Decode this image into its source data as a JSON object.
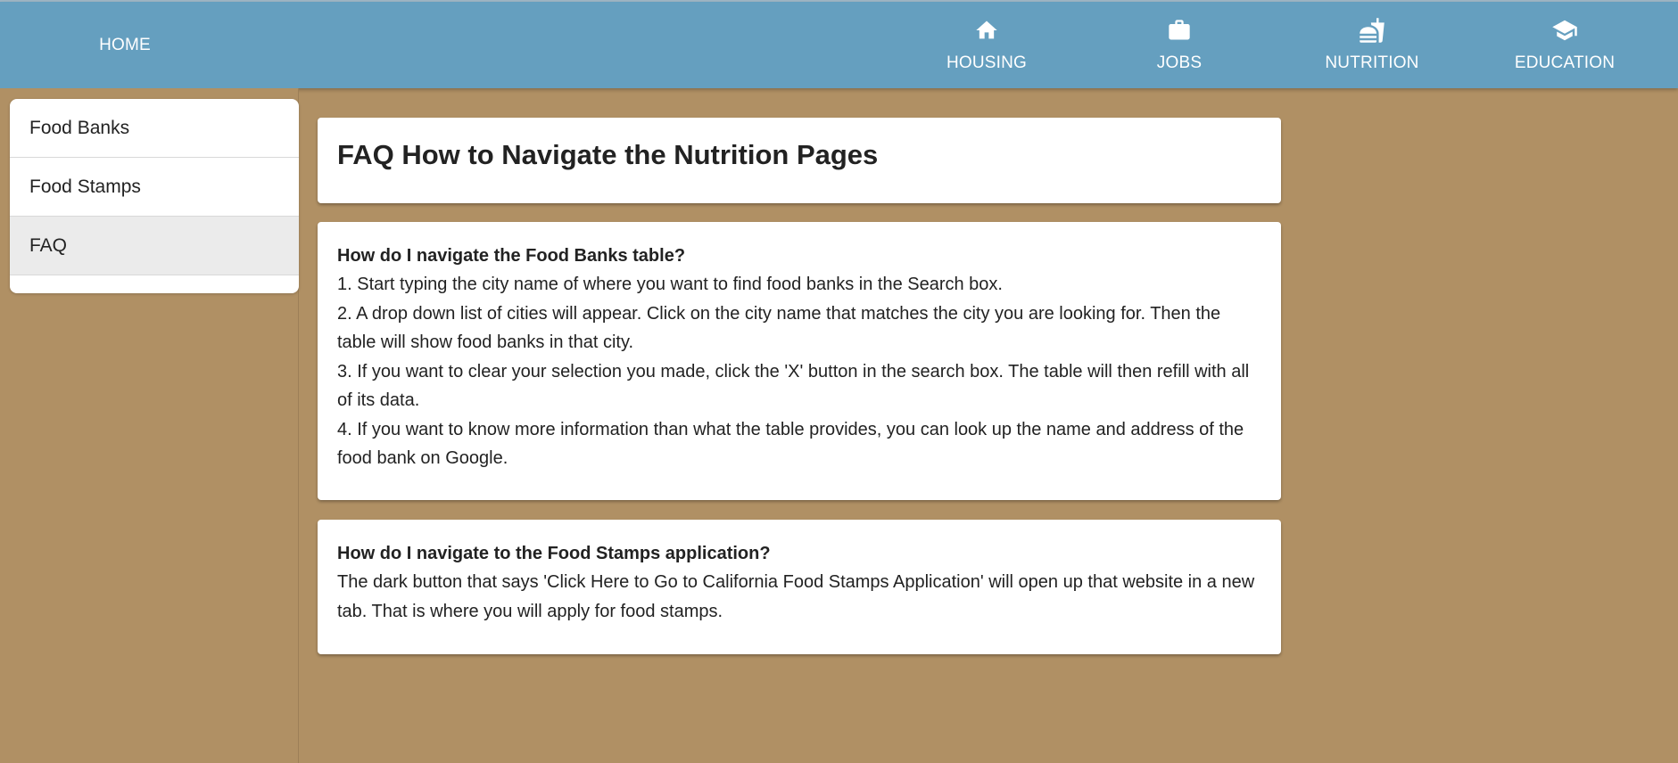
{
  "nav": {
    "home": "HOME",
    "items": [
      {
        "label": "HOUSING",
        "icon": "home-icon"
      },
      {
        "label": "JOBS",
        "icon": "briefcase-icon"
      },
      {
        "label": "NUTRITION",
        "icon": "fastfood-icon"
      },
      {
        "label": "EDUCATION",
        "icon": "graduation-cap-icon"
      }
    ]
  },
  "sidebar": {
    "items": [
      {
        "label": "Food Banks",
        "active": false
      },
      {
        "label": "Food Stamps",
        "active": false
      },
      {
        "label": "FAQ",
        "active": true
      }
    ]
  },
  "main": {
    "title": "FAQ How to Navigate the Nutrition Pages",
    "faq": [
      {
        "question": "How do I navigate the Food Banks table?",
        "answers": [
          "1. Start typing the city name of where you want to find food banks in the Search box.",
          "2. A drop down list of cities will appear. Click on the city name that matches the city you are looking for. Then the table will show food banks in that city.",
          "3. If you want to clear your selection you made, click the 'X' button in the search box. The table will then refill with all of its data.",
          "4. If you want to know more information than what the table provides, you can look up the name and address of the food bank on Google."
        ]
      },
      {
        "question": "How do I navigate to the Food Stamps application?",
        "answers": [
          "The dark button that says 'Click Here to Go to California Food Stamps Application' will open up that website in a new tab. That is where you will apply for food stamps."
        ]
      }
    ]
  },
  "colors": {
    "navbar": "#659fbf",
    "background": "#b09064",
    "card": "#ffffff",
    "active_sidebar": "#ebebeb"
  }
}
